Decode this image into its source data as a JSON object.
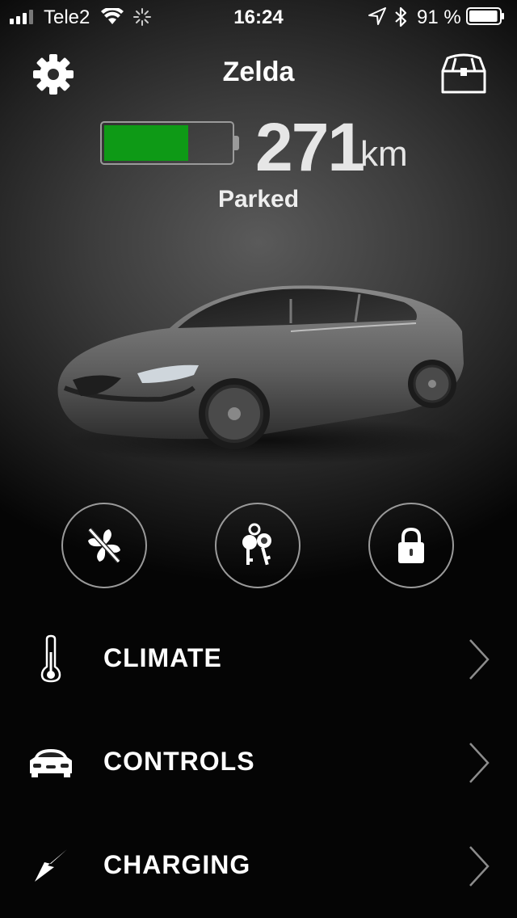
{
  "status_bar": {
    "carrier": "Tele2",
    "time": "16:24",
    "battery_percent_text": "91 %",
    "battery_level": 0.91,
    "icons": [
      "signal-icon",
      "wifi-icon",
      "activity-spinner-icon",
      "location-icon",
      "bluetooth-icon",
      "battery-icon"
    ]
  },
  "header": {
    "title": "Zelda",
    "left_icon": "gear-icon",
    "right_icon": "treasure-chest-icon"
  },
  "range": {
    "value": "271",
    "unit": "km",
    "battery_fill_fraction": 0.68,
    "battery_color": "#0e9a16",
    "state": "Parked"
  },
  "car_image": "car-icon",
  "quick_actions": [
    {
      "icon": "fan-off-icon"
    },
    {
      "icon": "keys-icon"
    },
    {
      "icon": "lock-icon"
    }
  ],
  "menu": [
    {
      "label": "CLIMATE",
      "icon": "thermometer-icon"
    },
    {
      "label": "CONTROLS",
      "icon": "car-front-icon"
    },
    {
      "label": "CHARGING",
      "icon": "lightning-icon"
    }
  ]
}
